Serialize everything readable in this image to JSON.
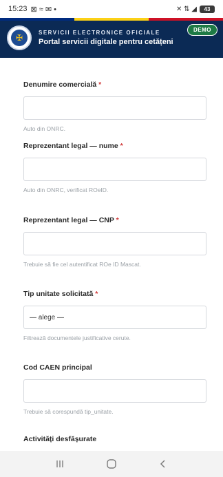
{
  "status_bar": {
    "time": "15:23",
    "left_icons": "⊠ ≈ ✉ •",
    "right_icons": "✕ ⇅ ◢",
    "battery": "43"
  },
  "header": {
    "kicker": "SERVICII ELECTRONICE OFICIALE",
    "title": "Portal servicii digitale pentru cetățeni",
    "badge": "DEMO",
    "colors": {
      "navy": "#0b2a55",
      "blue": "#002b7f",
      "yellow": "#fcd116",
      "red": "#ce1126",
      "badge": "#1e7a45"
    }
  },
  "form": {
    "fields": [
      {
        "label": "Denumire comercială",
        "required_mark": "*",
        "value": "",
        "hint": "Auto din ONRC."
      },
      {
        "label": "Reprezentant legal — nume",
        "required_mark": "*",
        "value": "",
        "hint": "Auto din ONRC, verificat ROeID."
      },
      {
        "label": "Reprezentant legal — CNP",
        "required_mark": "*",
        "value": "",
        "hint": "Trebuie să fie cel autentificat ROe ID Mascat."
      },
      {
        "label": "Tip unitate solicitată",
        "required_mark": "*",
        "value": "— alege —",
        "hint": "Filtrează documentele justificative cerute."
      },
      {
        "label": "Cod CAEN principal",
        "required_mark": "",
        "value": "",
        "hint": "Trebuie să corespundă tip_unitate."
      },
      {
        "label": "Activități desfășurate",
        "required_mark": "",
        "value": "",
        "hint": ""
      }
    ]
  },
  "nav_bar": {
    "recents_icon": "recents-icon",
    "home_icon": "home-icon",
    "back_icon": "back-icon"
  }
}
